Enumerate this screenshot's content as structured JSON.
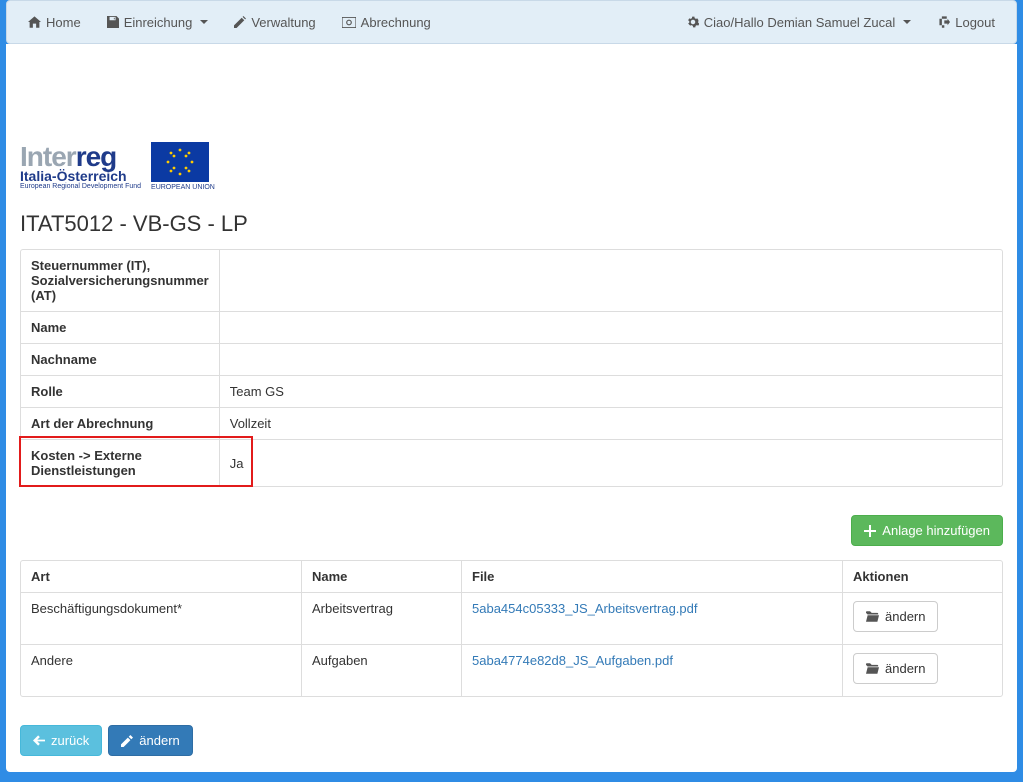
{
  "nav": {
    "home": "Home",
    "einreichung": "Einreichung",
    "verwaltung": "Verwaltung",
    "abrechnung": "Abrechnung",
    "user_greeting": "Ciao/Hallo Demian Samuel Zucal",
    "logout": "Logout"
  },
  "logo": {
    "brand_gray": "Inter",
    "brand_blue": "reg",
    "subtitle": "Italia-Österreich",
    "note": "European Regional Development Fund",
    "eu": "EUROPEAN UNION"
  },
  "page_title": "ITAT5012 - VB-GS - LP",
  "info": {
    "tax_label": "Steuernummer (IT), Sozialversicherungsnummer (AT)",
    "tax_value": "",
    "name_label": "Name",
    "name_value": "",
    "surname_label": "Nachname",
    "surname_value": "",
    "role_label": "Rolle",
    "role_value": "Team GS",
    "billing_label": "Art der Abrechnung",
    "billing_value": "Vollzeit",
    "costs_label": "Kosten -> Externe Dienstleistungen",
    "costs_value": "Ja"
  },
  "buttons": {
    "add_attachment": "Anlage hinzufügen",
    "edit": "ändern",
    "back": "zurück",
    "footer_edit": "ändern"
  },
  "att_headers": {
    "art": "Art",
    "name": "Name",
    "file": "File",
    "actions": "Aktionen"
  },
  "attachments": [
    {
      "art": "Beschäftigungsdokument*",
      "name": "Arbeitsvertrag",
      "file": "5aba454c05333_JS_Arbeitsvertrag.pdf"
    },
    {
      "art": "Andere",
      "name": "Aufgaben",
      "file": "5aba4774e82d8_JS_Aufgaben.pdf"
    }
  ]
}
